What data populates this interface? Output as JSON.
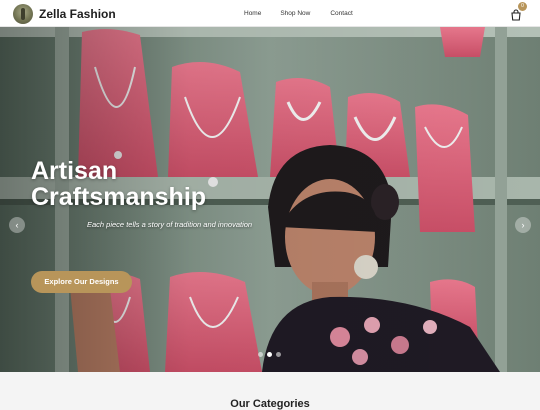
{
  "header": {
    "brand": "Zella Fashion",
    "nav": {
      "home": "Home",
      "shop": "Shop Now",
      "contact": "Contact"
    },
    "cart_count": "0"
  },
  "hero": {
    "title_line1": "Artisan",
    "title_line2": "Craftsmanship",
    "subtitle": "Each piece tells a story of tradition and innovation",
    "cta": "Explore Our Designs",
    "prev": "‹",
    "next": "›",
    "slides": 3,
    "active_slide": 2
  },
  "categories": {
    "title": "Our Categories"
  },
  "colors": {
    "accent": "#b8955a",
    "header_bg": "#ffffff",
    "page_bg": "#f4f4f4"
  }
}
